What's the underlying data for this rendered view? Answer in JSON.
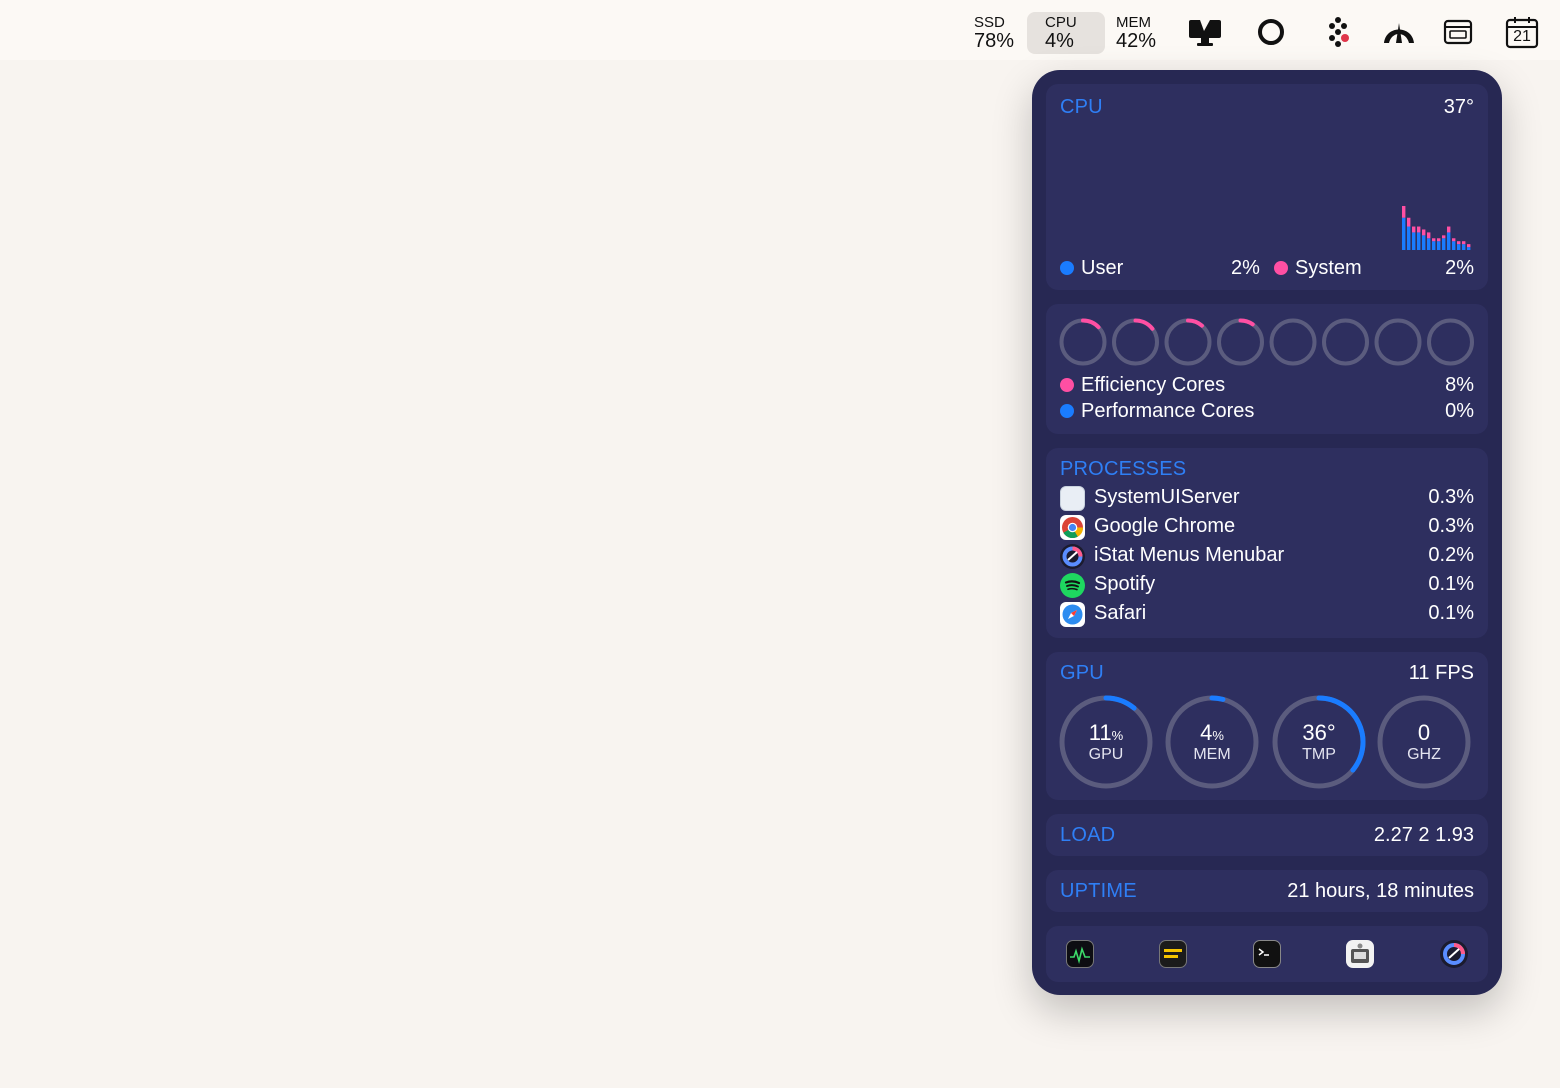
{
  "menubar": {
    "stats": [
      {
        "label": "SSD",
        "value": "78%"
      },
      {
        "label": "CPU",
        "value": "4%"
      },
      {
        "label": "MEM",
        "value": "42%"
      }
    ],
    "calendar_day": "21",
    "icons": [
      "display-icon",
      "circle-icon",
      "diamond-dots-icon",
      "arch-icon",
      "keyboard-window-icon",
      "calendar-icon"
    ]
  },
  "cpu": {
    "title": "CPU",
    "temperature": "37°",
    "user_label": "User",
    "user_value": "2%",
    "system_label": "System",
    "system_value": "2%",
    "colors": {
      "user": "#1a7cff",
      "system": "#ff4fa3",
      "accent": "#2f7ff5"
    },
    "history": {
      "user": [
        11,
        8,
        6,
        6,
        5,
        4,
        3,
        3,
        4,
        6,
        3,
        2,
        2,
        1
      ],
      "system": [
        4,
        3,
        2,
        2,
        2,
        2,
        1,
        1,
        1,
        2,
        1,
        1,
        1,
        1
      ]
    }
  },
  "cores": {
    "loads": [
      0.08,
      0.09,
      0.07,
      0.06,
      0,
      0,
      0,
      0
    ],
    "efficiency_label": "Efficiency Cores",
    "efficiency_value": "8%",
    "performance_label": "Performance Cores",
    "performance_value": "0%"
  },
  "processes": {
    "title": "PROCESSES",
    "items": [
      {
        "name": "SystemUIServer",
        "value": "0.3%",
        "icon": "systemuiserver-icon"
      },
      {
        "name": "Google Chrome",
        "value": "0.3%",
        "icon": "chrome-icon"
      },
      {
        "name": "iStat Menus Menubar",
        "value": "0.2%",
        "icon": "istat-icon"
      },
      {
        "name": "Spotify",
        "value": "0.1%",
        "icon": "spotify-icon"
      },
      {
        "name": "Safari",
        "value": "0.1%",
        "icon": "safari-icon"
      }
    ]
  },
  "gpu": {
    "title": "GPU",
    "fps": "11 FPS",
    "gauges": [
      {
        "value": "11",
        "unit": "%",
        "label": "GPU",
        "fraction": 0.11
      },
      {
        "value": "4",
        "unit": "%",
        "label": "MEM",
        "fraction": 0.04
      },
      {
        "value": "36°",
        "unit": "",
        "label": "TMP",
        "fraction": 0.36
      },
      {
        "value": "0",
        "unit": "",
        "label": "GHZ",
        "fraction": 0
      }
    ]
  },
  "load": {
    "title": "LOAD",
    "value": "2.27 2 1.93"
  },
  "uptime": {
    "title": "UPTIME",
    "value": "21 hours, 18 minutes"
  },
  "dock": {
    "icons": [
      "activity-monitor-icon",
      "console-icon",
      "terminal-icon",
      "system-information-icon",
      "istat-menus-icon"
    ]
  }
}
